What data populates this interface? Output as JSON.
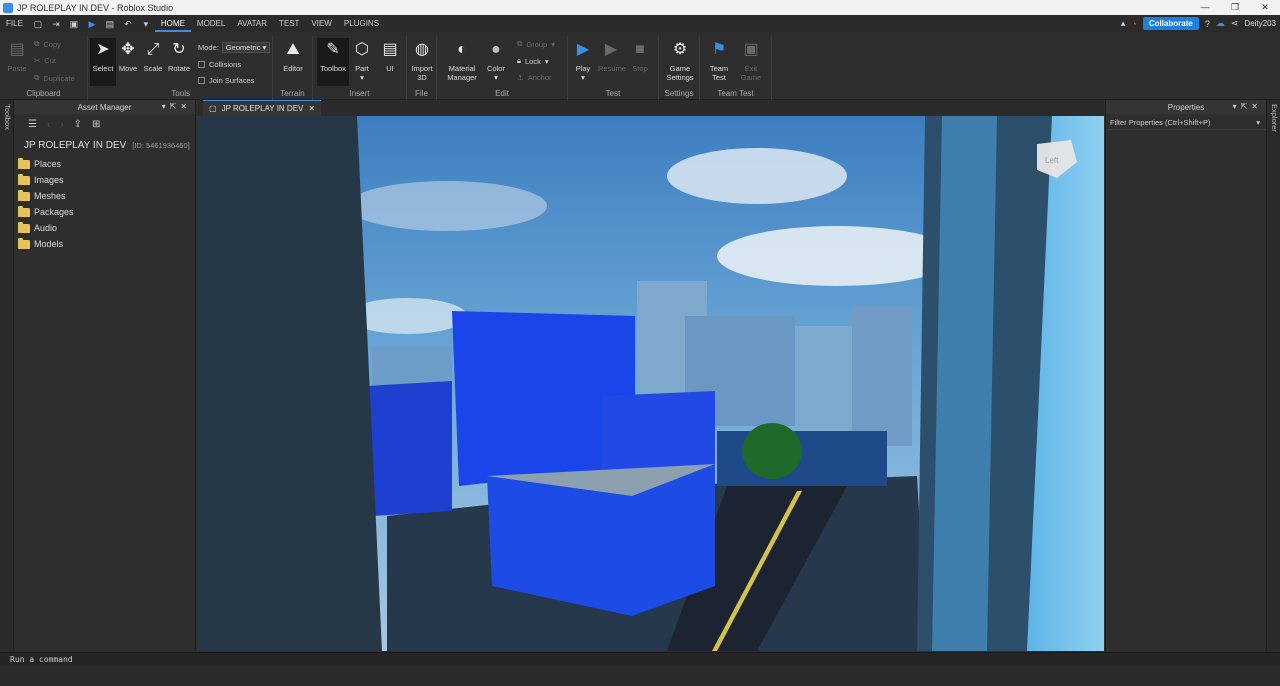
{
  "window": {
    "title": "JP ROLEPLAY IN DEV - Roblox Studio",
    "controls": [
      "—",
      "❐",
      "✕"
    ]
  },
  "menubar": {
    "tabs": [
      "FILE",
      "HOME",
      "MODEL",
      "AVATAR",
      "TEST",
      "VIEW",
      "PLUGINS"
    ],
    "active_tab": "HOME",
    "collaborate": "Collaborate",
    "user": "Deity203"
  },
  "ribbon": {
    "clipboard": {
      "label": "Clipboard",
      "paste": "Paste",
      "copy": "Copy",
      "cut": "Cut",
      "duplicate": "Duplicate"
    },
    "tools": {
      "label": "Tools",
      "select": "Select",
      "move": "Move",
      "scale": "Scale",
      "rotate": "Rotate",
      "mode_label": "Mode:",
      "mode_value": "Geometric",
      "collisions": "Collisions",
      "join_surfaces": "Join Surfaces"
    },
    "terrain": {
      "label": "Terrain",
      "editor": "Editor"
    },
    "insert": {
      "label": "Insert",
      "toolbox": "Toolbox",
      "part": "Part",
      "ui": "UI"
    },
    "file": {
      "label": "File",
      "import3d_l1": "Import",
      "import3d_l2": "3D"
    },
    "edit": {
      "label": "Edit",
      "material_l1": "Material",
      "material_l2": "Manager",
      "color": "Color",
      "group": "Group",
      "lock": "Lock",
      "anchor": "Anchor"
    },
    "test": {
      "label": "Test",
      "play": "Play",
      "resume": "Resume",
      "stop": "Stop"
    },
    "settings": {
      "label": "Settings",
      "game_l1": "Game",
      "game_l2": "Settings"
    },
    "teamtest": {
      "label": "Team Test",
      "team_l1": "Team",
      "team_l2": "Test",
      "exit_l1": "Exit",
      "exit_l2": "Game"
    }
  },
  "left_strip": {
    "toolbox": "Toolbox"
  },
  "asset_manager": {
    "title": "Asset Manager",
    "game_name": "JP ROLEPLAY IN DEV",
    "game_id": "[ID: 5461936460]",
    "folders": [
      "Places",
      "Images",
      "Meshes",
      "Packages",
      "Audio",
      "Models"
    ]
  },
  "document_tab": {
    "label": "JP ROLEPLAY IN DEV"
  },
  "viewcube": {
    "face": "Left"
  },
  "properties": {
    "title": "Properties",
    "filter": "Filter Properties (Ctrl+Shift+P)"
  },
  "right_strip": {
    "explorer": "Explorer"
  },
  "command_bar": {
    "placeholder": "Run a command"
  },
  "colors": {
    "accent": "#3a8ee6",
    "collaborate": "#1f7fe0",
    "folder": "#e8c25a",
    "panel": "#2e2e2e"
  }
}
